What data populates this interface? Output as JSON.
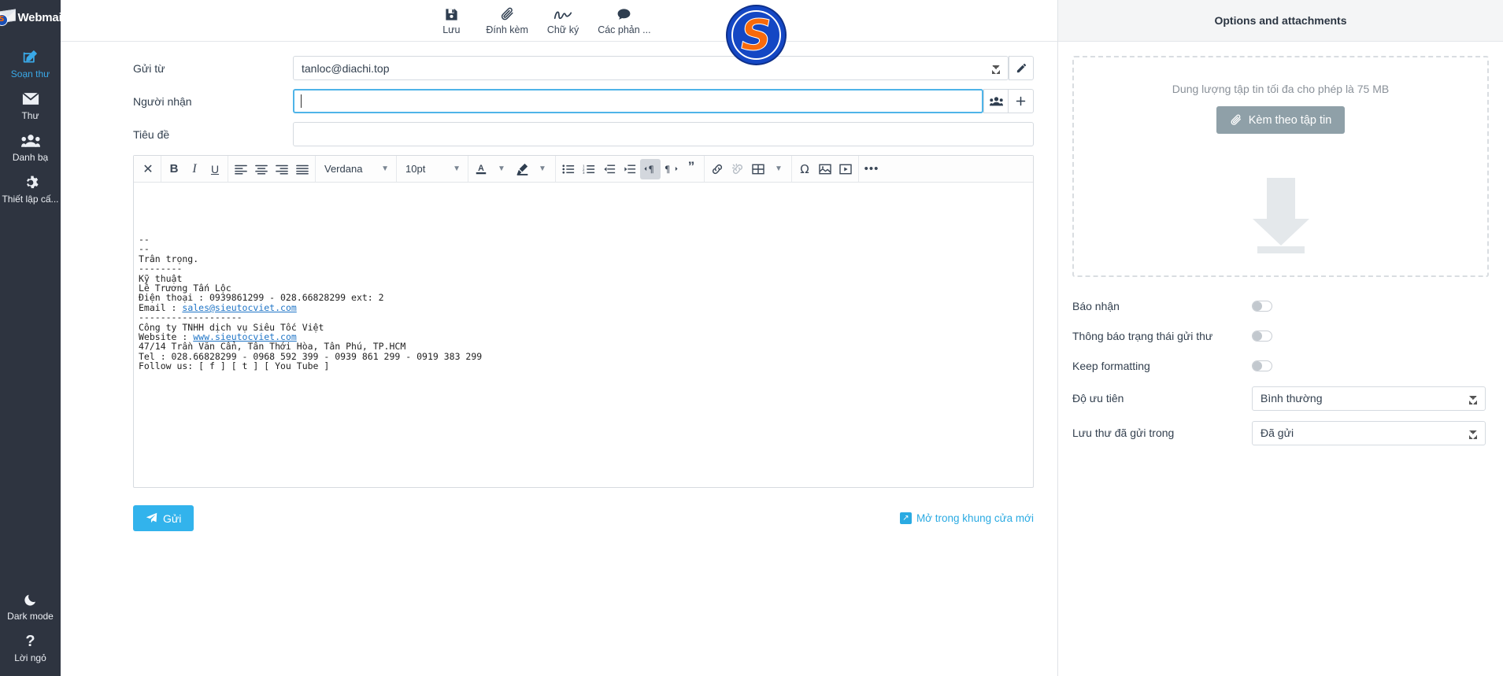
{
  "sidebar": {
    "brand": {
      "text": "Webmail",
      "badge_letter": "S"
    },
    "items": [
      {
        "label": "Soạn thư",
        "icon": "compose-icon",
        "active": true
      },
      {
        "label": "Thư",
        "icon": "envelope-icon",
        "active": false
      },
      {
        "label": "Danh bạ",
        "icon": "contacts-icon",
        "active": false
      },
      {
        "label": "Thiết lập cấ...",
        "icon": "gear-icon",
        "active": false
      }
    ],
    "bottom": [
      {
        "label": "Dark mode",
        "icon": "moon-icon"
      },
      {
        "label": "Lời ngỏ",
        "icon": "question-icon"
      }
    ]
  },
  "topbar": {
    "actions": [
      {
        "label": "Lưu",
        "icon": "save-icon"
      },
      {
        "label": "Đính kèm",
        "icon": "paperclip-icon"
      },
      {
        "label": "Chữ ký",
        "icon": "signature-icon"
      },
      {
        "label": "Các phản ...",
        "icon": "comment-icon"
      }
    ],
    "logo_letter": "S"
  },
  "compose": {
    "from": {
      "label": "Gửi từ",
      "value": "tanloc@diachi.top",
      "edit_icon": "pencil-icon"
    },
    "to": {
      "label": "Người nhận",
      "value": "",
      "contacts_icon": "contacts-icon",
      "add_icon": "plus-icon"
    },
    "subject": {
      "label": "Tiêu đề",
      "value": ""
    },
    "editor": {
      "font_family": "Verdana",
      "font_size": "10pt",
      "buttons": [
        {
          "name": "clear-formatting",
          "glyph": "✕"
        },
        {
          "name": "bold",
          "glyph": "B"
        },
        {
          "name": "italic",
          "glyph": "I"
        },
        {
          "name": "underline",
          "glyph": "U"
        },
        {
          "name": "align-left"
        },
        {
          "name": "align-center"
        },
        {
          "name": "align-right"
        },
        {
          "name": "align-justify"
        },
        {
          "name": "text-color",
          "glyph": "A"
        },
        {
          "name": "highlight-color"
        },
        {
          "name": "bullet-list"
        },
        {
          "name": "numbered-list"
        },
        {
          "name": "outdent"
        },
        {
          "name": "indent"
        },
        {
          "name": "ltr-direction",
          "active": true
        },
        {
          "name": "rtl-direction"
        },
        {
          "name": "blockquote",
          "glyph": "❞"
        },
        {
          "name": "insert-link"
        },
        {
          "name": "remove-link"
        },
        {
          "name": "insert-table"
        },
        {
          "name": "special-character",
          "glyph": "Ω"
        },
        {
          "name": "insert-image"
        },
        {
          "name": "insert-media"
        },
        {
          "name": "more-options",
          "glyph": "•••"
        }
      ],
      "signature_lines": [
        "--",
        "--",
        "Trân trọng.",
        "--------",
        "Kỹ thuật",
        "Lê Trương Tấn Lộc",
        "Điện thoại : 0939861299 - 028.66828299 ext: 2",
        "Email : sales@sieutocviet.com",
        "-------------------",
        "Công ty TNHH dịch vụ Siêu Tốc Việt",
        "Website : www.sieutocviet.com",
        "47/14 Trần Văn Cẩn, Tân Thới Hòa, Tân Phú, TP.HCM",
        "Tel : 028.66828299 - 0968 592 399 - 0939 861 299 - 0919 383 299",
        "Follow us: [ f ] [ t ] [ You Tube ]"
      ],
      "signature_email_link": "sales@sieutocviet.com",
      "signature_website_link": "www.sieutocviet.com"
    },
    "send_label": "Gửi",
    "popout_label": "Mở trong khung cửa mới"
  },
  "options": {
    "title": "Options and attachments",
    "dropzone": {
      "note": "Dung lượng tập tin tối đa cho phép là 75 MB",
      "button_label": "Kèm theo tập tin"
    },
    "toggles": [
      {
        "label": "Báo nhận",
        "on": false
      },
      {
        "label": "Thông báo trạng thái gửi thư",
        "on": false
      },
      {
        "label": "Keep formatting",
        "on": false
      }
    ],
    "selects": [
      {
        "label": "Độ ưu tiên",
        "value": "Bình thường"
      },
      {
        "label": "Lưu thư đã gửi trong",
        "value": "Đã gửi"
      }
    ]
  },
  "colors": {
    "sidebar_bg": "#2e3440",
    "accent": "#32b3ec",
    "logo_blue": "#1447c4",
    "logo_orange": "#f96a0c"
  }
}
